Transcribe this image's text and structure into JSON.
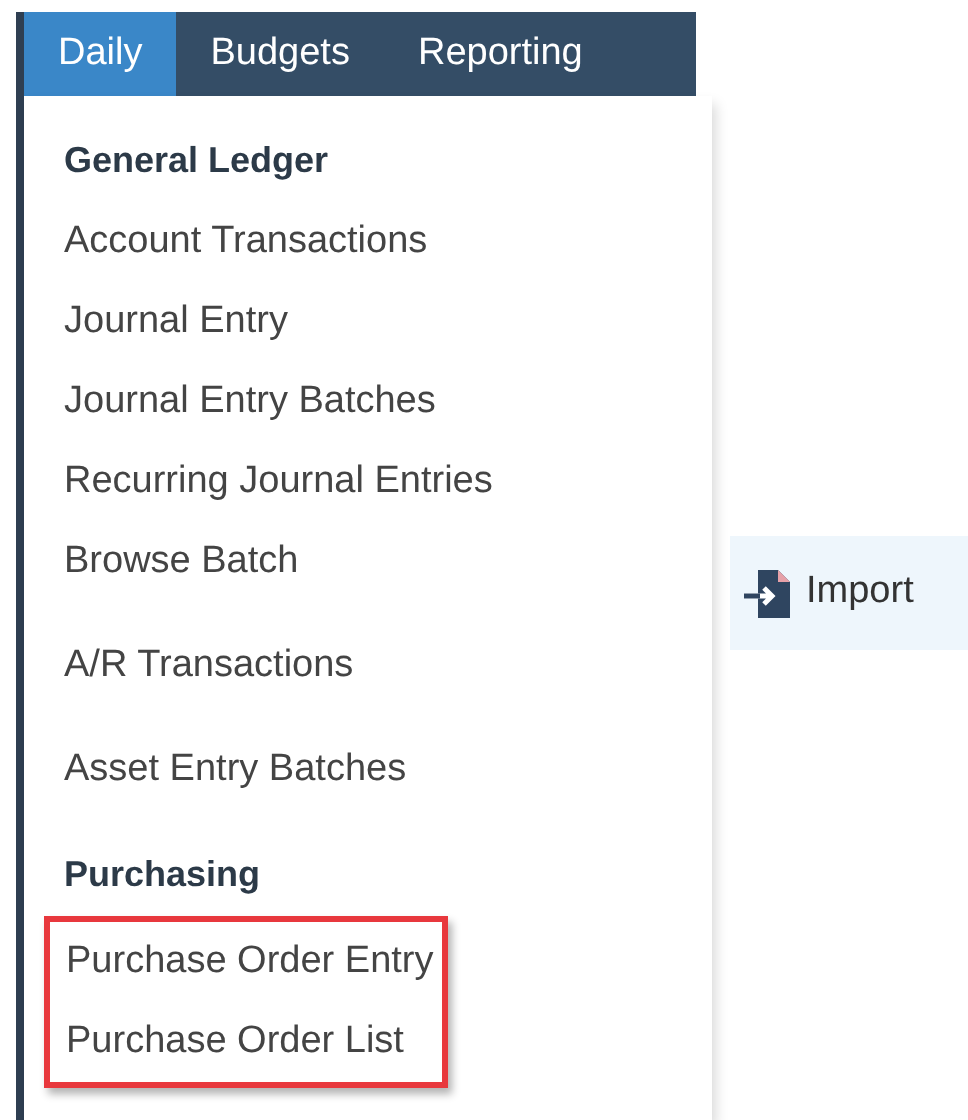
{
  "tabs": [
    {
      "label": "Daily",
      "selected": true
    },
    {
      "label": "Budgets",
      "selected": false
    },
    {
      "label": "Reporting",
      "selected": false
    }
  ],
  "menu_groups": [
    {
      "heading": "General Ledger",
      "items": [
        {
          "label": "Account Transactions",
          "highlighted": false
        },
        {
          "label": "Journal Entry",
          "highlighted": false
        },
        {
          "label": "Journal Entry Batches",
          "highlighted": false
        },
        {
          "label": "Recurring Journal Entries",
          "highlighted": false
        },
        {
          "label": "Browse Batch",
          "highlighted": false
        }
      ]
    },
    {
      "items": [
        {
          "label": "A/R Transactions",
          "highlighted": false
        }
      ]
    },
    {
      "items": [
        {
          "label": "Asset Entry Batches",
          "highlighted": false
        }
      ]
    },
    {
      "heading": "Purchasing",
      "items": [
        {
          "label": "Purchase Order Entry",
          "highlighted": true
        },
        {
          "label": "Purchase Order List",
          "highlighted": true
        }
      ]
    }
  ],
  "import_button": {
    "label": "Import"
  }
}
